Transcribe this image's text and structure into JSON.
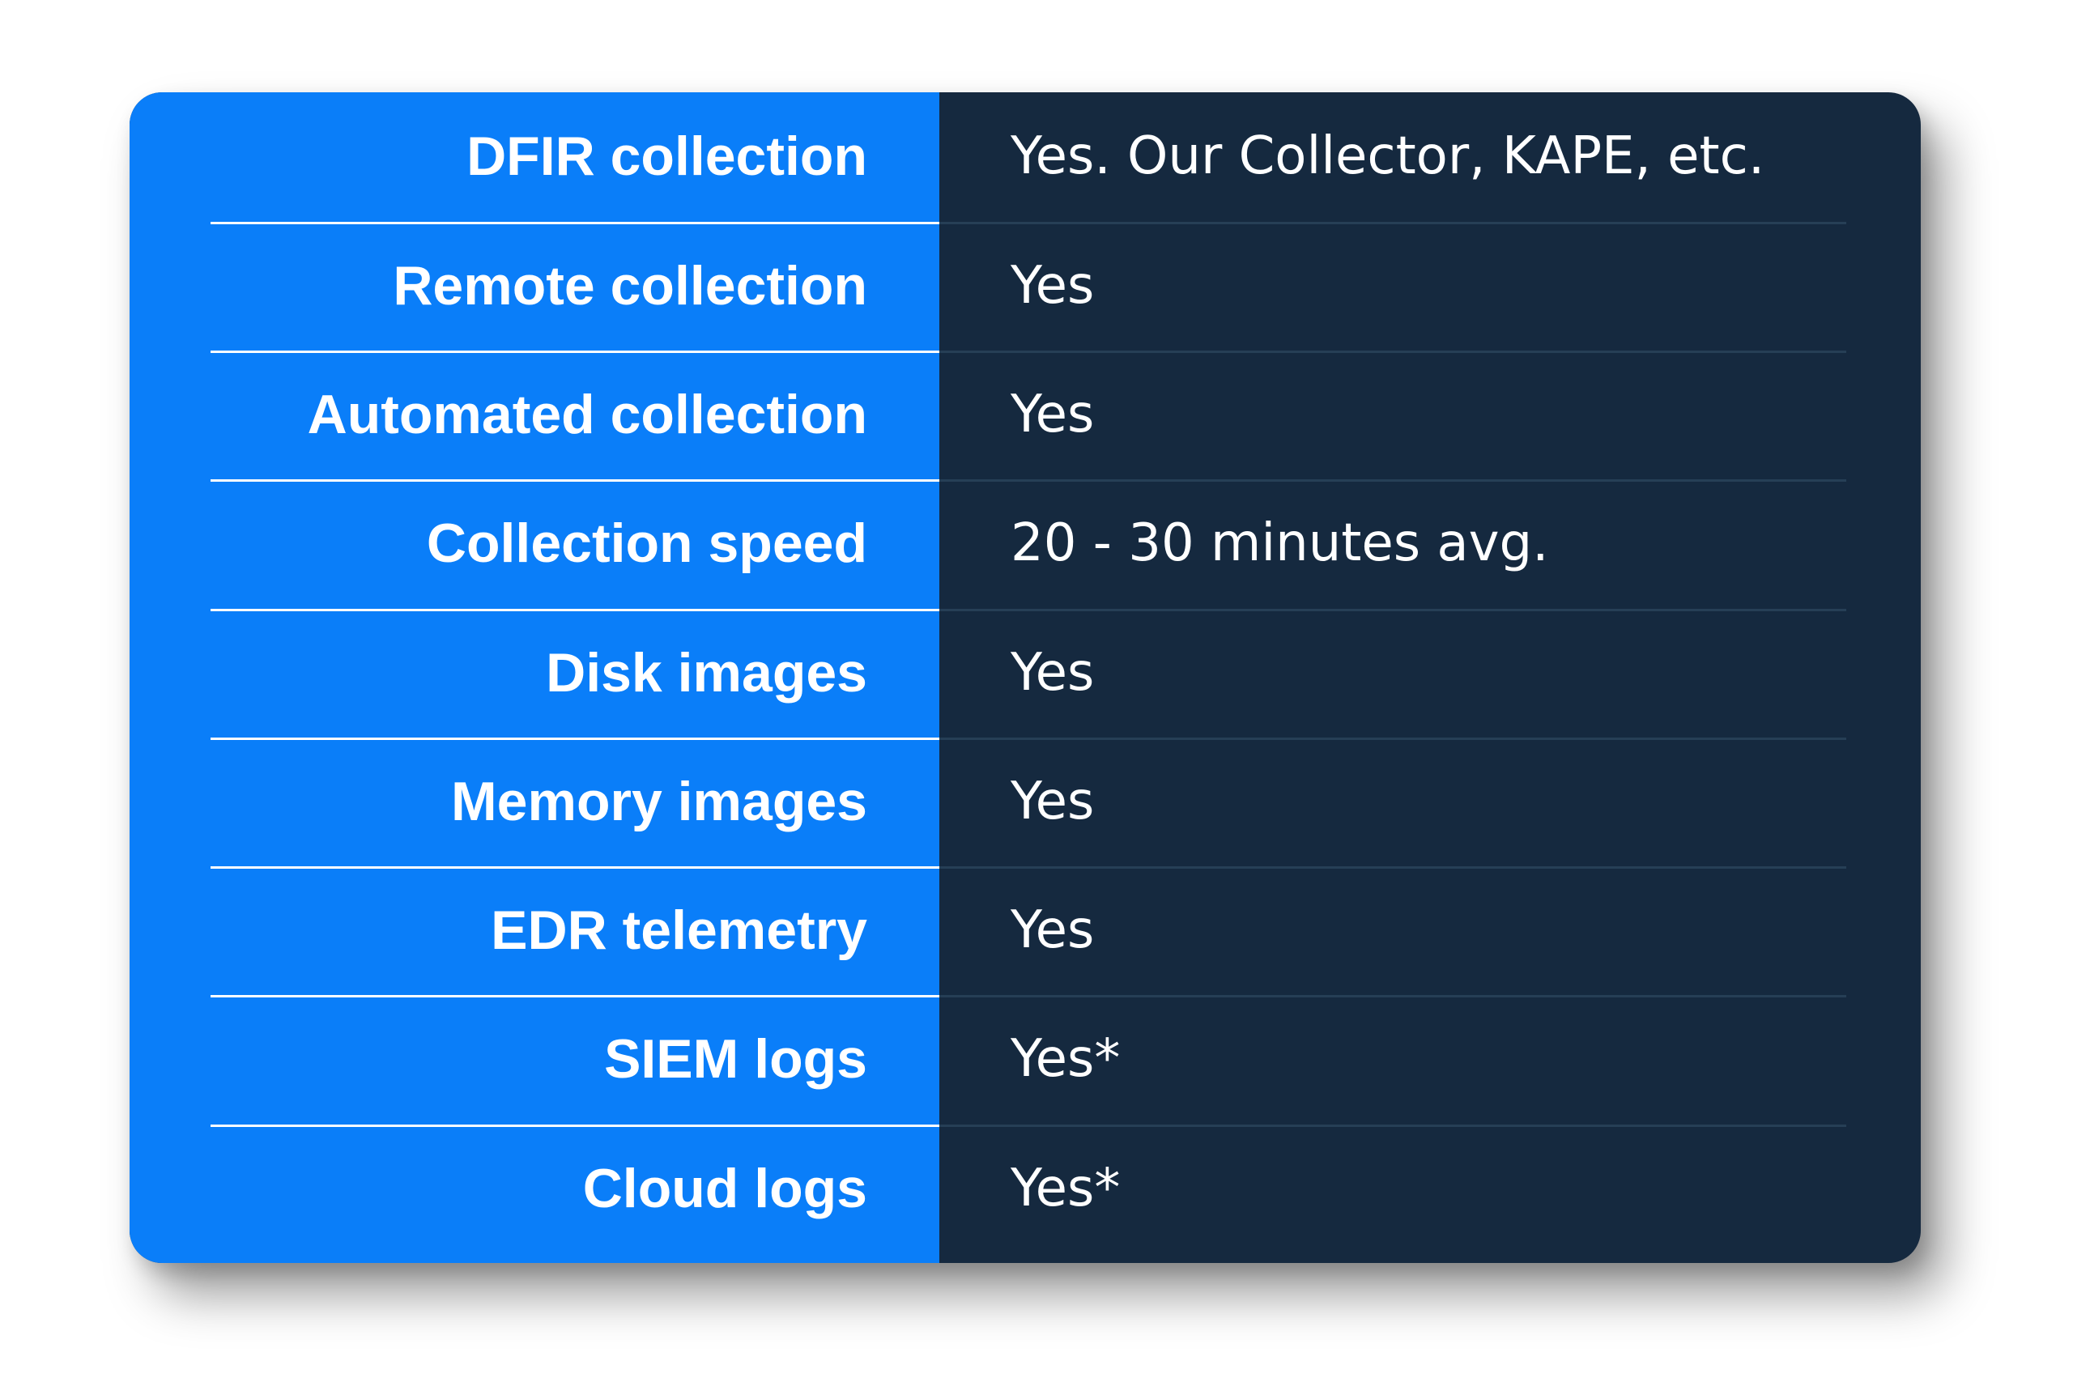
{
  "colors": {
    "label_column": "#0a7ef9",
    "value_column": "#15293f",
    "text": "#ffffff"
  },
  "rows": [
    {
      "label": "DFIR collection",
      "value": "Yes. Our Collector, KAPE, etc."
    },
    {
      "label": "Remote collection",
      "value": "Yes"
    },
    {
      "label": "Automated collection",
      "value": "Yes"
    },
    {
      "label": "Collection speed",
      "value": "20 - 30 minutes avg."
    },
    {
      "label": "Disk images",
      "value": "Yes"
    },
    {
      "label": "Memory images",
      "value": "Yes"
    },
    {
      "label": "EDR telemetry",
      "value": "Yes"
    },
    {
      "label": "SIEM logs",
      "value": "Yes*"
    },
    {
      "label": "Cloud logs",
      "value": "Yes*"
    }
  ]
}
